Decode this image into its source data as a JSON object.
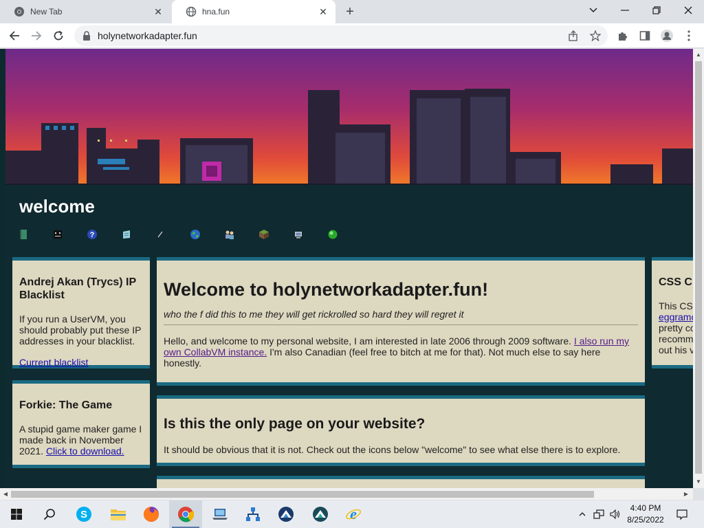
{
  "browser": {
    "tabs": [
      {
        "title": "New Tab",
        "active": false
      },
      {
        "title": "hna.fun",
        "active": true
      }
    ],
    "new_tab_label": "+",
    "url": "holynetworkadapter.fun"
  },
  "site": {
    "title": "welcome",
    "nav_icons": [
      "book-icon",
      "smiley-icon",
      "help-icon",
      "notepad-icon",
      "pen-icon",
      "globe-icon",
      "users-icon",
      "cube-icon",
      "computer-icon",
      "green-orb-icon"
    ],
    "sidebar_left": [
      {
        "heading": "Andrej Akan (Trycs) IP Blacklist",
        "text": "If you run a UserVM, you should probably put these IP addresses in your blacklist.",
        "link": "Current blacklist"
      },
      {
        "heading": "Forkie: The Game",
        "text": "A stupid game maker game I made back in November 2021.",
        "link": "Click to download."
      }
    ],
    "main": {
      "welcome": {
        "heading": "Welcome to holynetworkadapter.fun!",
        "tagline": "who the f did this to me they will get rickrolled so hard they will regret it",
        "body_start": "Hello, and welcome to my personal website, I am interested in late 2006 through 2009 software.",
        "link": "I also run my own CollabVM instance.",
        "body_end": "I'm also Canadian (feel free to bitch at me for that). Not much else to say here honestly."
      },
      "pages": {
        "heading": "Is this the only page on your website?",
        "text": "It should be obvious that it is not. Check out the icons below \"welcome\" to see what else there is to explore."
      }
    },
    "sidebar_right": {
      "heading": "CSS C",
      "line1": "This CS",
      "link": "eggramo",
      "line2": "pretty co",
      "line3": "recomm",
      "line4": "out his v"
    }
  },
  "taskbar": {
    "apps": [
      "start-icon",
      "search-icon",
      "skype-icon",
      "file-explorer-icon",
      "firefox-icon",
      "chrome-icon",
      "laptop-app-icon",
      "network-app-icon",
      "app-circle-icon",
      "app-circle-2-icon",
      "internet-explorer-icon"
    ],
    "time": "4:40 PM",
    "date": "8/25/2022"
  }
}
